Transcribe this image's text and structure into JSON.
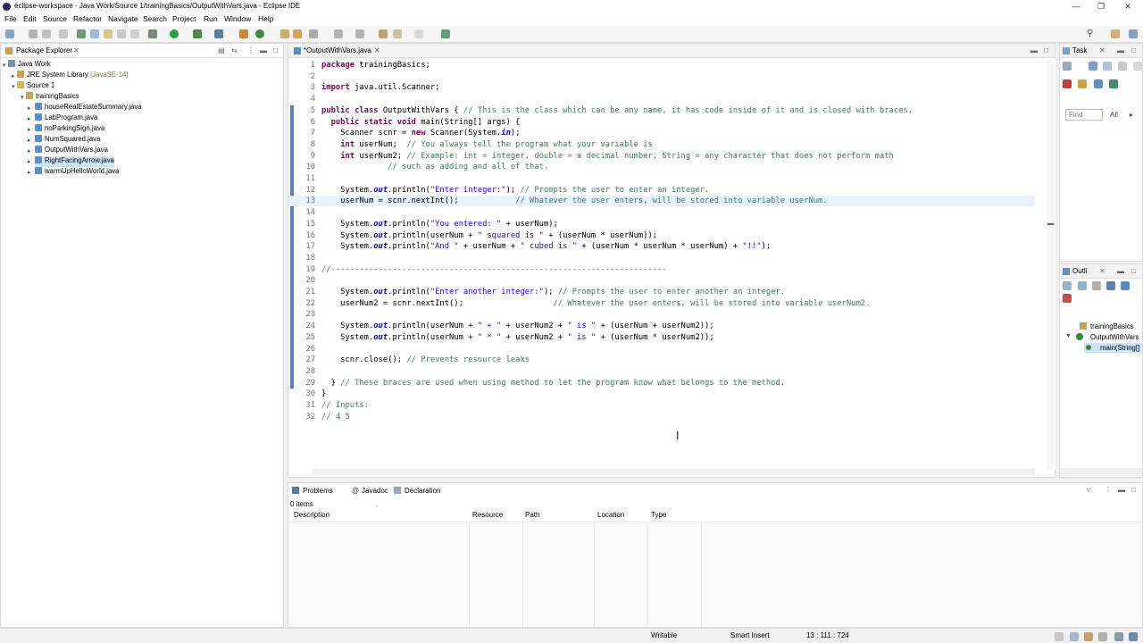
{
  "window": {
    "title": "eclipse-workspace - Java Work/Source 1/trainingBasics/OutputWithVars.java - Eclipse IDE"
  },
  "menu": [
    "File",
    "Edit",
    "Source",
    "Refactor",
    "Navigate",
    "Search",
    "Project",
    "Run",
    "Window",
    "Help"
  ],
  "package_explorer": {
    "tab": "Package Explorer",
    "tree": [
      {
        "label": "Java Work",
        "level": 0,
        "icon": "project-icon"
      },
      {
        "label": "JRE System Library",
        "suffix": "[JavaSE-14]",
        "level": 1,
        "icon": "library-icon"
      },
      {
        "label": "Source 1",
        "level": 1,
        "icon": "source-folder-icon"
      },
      {
        "label": "trainingBasics",
        "level": 2,
        "icon": "package-icon"
      },
      {
        "label": "houseRealEstateSummary.java",
        "level": 3,
        "icon": "java-file-icon"
      },
      {
        "label": "LabProgram.java",
        "level": 3,
        "icon": "java-file-icon"
      },
      {
        "label": "noParkingSign.java",
        "level": 3,
        "icon": "java-file-icon"
      },
      {
        "label": "NumSquared.java",
        "level": 3,
        "icon": "java-file-icon"
      },
      {
        "label": "OutputWithVars.java",
        "level": 3,
        "icon": "java-file-icon"
      },
      {
        "label": "RightFacingArrow.java",
        "level": 3,
        "icon": "java-file-icon"
      },
      {
        "label": "warmUpHelloWorld.java",
        "level": 3,
        "icon": "java-file-icon"
      }
    ]
  },
  "editor": {
    "tab": "*OutputWithVars.java",
    "lines": [
      {
        "n": "1",
        "t": [
          [
            "kw",
            "package"
          ],
          [
            "",
            "trainingBasics;"
          ]
        ]
      },
      {
        "n": "2",
        "t": []
      },
      {
        "n": "3",
        "t": [
          [
            "kw",
            "import"
          ],
          [
            "",
            "java.util.Scanner;"
          ]
        ]
      },
      {
        "n": "4",
        "t": []
      },
      {
        "n": "5",
        "t": [
          [
            "kw",
            "public class"
          ],
          [
            "",
            " OutputWithVars { "
          ],
          [
            "cm",
            "// This is the class which can be any name, it has code inside of it and is closed with braces."
          ]
        ]
      },
      {
        "n": "6",
        "t": [
          [
            "",
            "  "
          ],
          [
            "kw",
            "public static void"
          ],
          [
            "",
            " main(String[] args) {"
          ]
        ]
      },
      {
        "n": "7",
        "t": [
          [
            "",
            "    Scanner scnr = "
          ],
          [
            "kw",
            "new"
          ],
          [
            "",
            " Scanner(System."
          ],
          [
            "fi",
            "in"
          ],
          [
            "",
            ");"
          ]
        ]
      },
      {
        "n": "8",
        "t": [
          [
            "",
            "    "
          ],
          [
            "kw",
            "int"
          ],
          [
            "",
            " userNum;  "
          ],
          [
            "cm",
            "// You always tell the program what your variable is"
          ]
        ]
      },
      {
        "n": "9",
        "t": [
          [
            "",
            "    "
          ],
          [
            "kw",
            "int"
          ],
          [
            "",
            " userNum2; "
          ],
          [
            "cm",
            "// Example: int = integer, double = a decimal number, String = any character that does not perform math"
          ]
        ]
      },
      {
        "n": "10",
        "t": [
          [
            "",
            "              "
          ],
          [
            "cm",
            "// such as adding and all of that."
          ]
        ]
      },
      {
        "n": "11",
        "t": []
      },
      {
        "n": "12",
        "t": [
          [
            "",
            "    System."
          ],
          [
            "fi",
            "out"
          ],
          [
            "",
            ".println("
          ],
          [
            "st",
            "\"Enter integer:\""
          ],
          [
            "",
            "); "
          ],
          [
            "cm",
            "// Prompts the user to enter an integer."
          ]
        ]
      },
      {
        "n": "13",
        "t": [
          [
            "",
            "    userNum = scnr.nextInt();            "
          ],
          [
            "cm",
            "// Whatever the user enters, will be stored into variable userNum."
          ]
        ]
      },
      {
        "n": "14",
        "t": []
      },
      {
        "n": "15",
        "t": [
          [
            "",
            "    System."
          ],
          [
            "fi",
            "out"
          ],
          [
            "",
            ".println("
          ],
          [
            "st",
            "\"You entered: \""
          ],
          [
            "",
            " + userNum);"
          ]
        ]
      },
      {
        "n": "16",
        "t": [
          [
            "",
            "    System."
          ],
          [
            "fi",
            "out"
          ],
          [
            "",
            ".println(userNum + "
          ],
          [
            "st",
            "\" squared is \""
          ],
          [
            "",
            " + (userNum * userNum));"
          ]
        ]
      },
      {
        "n": "17",
        "t": [
          [
            "",
            "    System."
          ],
          [
            "fi",
            "out"
          ],
          [
            "",
            ".println("
          ],
          [
            "st",
            "\"And \""
          ],
          [
            "",
            " + userNum + "
          ],
          [
            "st",
            "\" cubed is \""
          ],
          [
            "",
            " + (userNum * userNum * userNum) + "
          ],
          [
            "st",
            "\"!!\""
          ],
          [
            "",
            ");"
          ]
        ]
      },
      {
        "n": "18",
        "t": []
      },
      {
        "n": "19",
        "t": [
          [
            "cm",
            "//-----------------------------------------------------------------------"
          ]
        ]
      },
      {
        "n": "20",
        "t": []
      },
      {
        "n": "21",
        "t": [
          [
            "",
            "    System."
          ],
          [
            "fi",
            "out"
          ],
          [
            "",
            ".println("
          ],
          [
            "st",
            "\"Enter another integer:\""
          ],
          [
            "",
            "); "
          ],
          [
            "cm",
            "// Prompts the user to enter another an integer."
          ]
        ]
      },
      {
        "n": "22",
        "t": [
          [
            "",
            "    userNum2 = scnr.nextInt();                   "
          ],
          [
            "cm",
            "// Whatever the user enters, will be stored into variable userNum2."
          ]
        ]
      },
      {
        "n": "23",
        "t": []
      },
      {
        "n": "24",
        "t": [
          [
            "",
            "    System."
          ],
          [
            "fi",
            "out"
          ],
          [
            "",
            ".println(userNum + "
          ],
          [
            "st",
            "\" + \""
          ],
          [
            "",
            " + userNum2 + "
          ],
          [
            "st",
            "\" is \""
          ],
          [
            "",
            " + (userNum + userNum2));"
          ]
        ]
      },
      {
        "n": "25",
        "t": [
          [
            "",
            "    System."
          ],
          [
            "fi",
            "out"
          ],
          [
            "",
            ".println(userNum + "
          ],
          [
            "st",
            "\" * \""
          ],
          [
            "",
            " + userNum2 + "
          ],
          [
            "st",
            "\" is \""
          ],
          [
            "",
            " + (userNum * userNum2));"
          ]
        ]
      },
      {
        "n": "26",
        "t": []
      },
      {
        "n": "27",
        "t": [
          [
            "",
            "    scnr.close(); "
          ],
          [
            "cm",
            "// Prevents resource leaks"
          ]
        ]
      },
      {
        "n": "28",
        "t": []
      },
      {
        "n": "29",
        "t": [
          [
            "",
            "  } "
          ],
          [
            "cm",
            "// These braces are used when using method to let the program know what belongs to the method."
          ]
        ]
      },
      {
        "n": "30",
        "t": [
          [
            "",
            "}"
          ]
        ]
      },
      {
        "n": "31",
        "t": [
          [
            "cm",
            "// Inputs:"
          ]
        ]
      },
      {
        "n": "32",
        "t": [
          [
            "cm",
            "// 4 5"
          ]
        ]
      }
    ]
  },
  "task_list": {
    "tab": "Task",
    "find_placeholder": "Find",
    "all_label": "All"
  },
  "outline": {
    "tab": "Outli",
    "items": [
      "trainingBasics",
      "OutputWithVars",
      "main(String[]"
    ]
  },
  "problems": {
    "tabs": [
      "Problems",
      "Javadoc",
      "Declaration"
    ],
    "count": "0 items",
    "columns": [
      "Description",
      "Resource",
      "Path",
      "Location",
      "Type"
    ]
  },
  "status": {
    "writable": "Writable",
    "insert_mode": "Smart Insert",
    "position": "13 : 111 : 724"
  }
}
